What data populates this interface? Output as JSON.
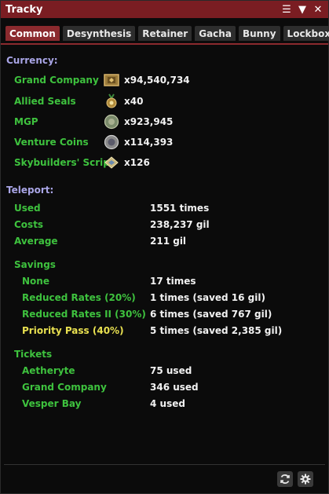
{
  "window": {
    "title": "Tracky"
  },
  "tabs": [
    "Common",
    "Desynthesis",
    "Retainer",
    "Gacha",
    "Bunny",
    "Lockbox"
  ],
  "currency": {
    "heading": "Currency:",
    "items": [
      {
        "label": "Grand Company",
        "value": "x94,540,734",
        "icon": "grand-company-seal-icon"
      },
      {
        "label": "Allied Seals",
        "value": "x40",
        "icon": "allied-seal-icon"
      },
      {
        "label": "MGP",
        "value": "x923,945",
        "icon": "mgp-coin-icon"
      },
      {
        "label": "Venture Coins",
        "value": "x114,393",
        "icon": "venture-coin-icon"
      },
      {
        "label": "Skybuilders' Scrip",
        "value": "x126",
        "icon": "skybuilders-scrip-icon"
      }
    ]
  },
  "teleport": {
    "heading": "Teleport:",
    "stats": [
      {
        "label": "Used",
        "value": "1551 times"
      },
      {
        "label": "Costs",
        "value": "238,237 gil"
      },
      {
        "label": "Average",
        "value": "211 gil"
      }
    ],
    "savings": {
      "heading": "Savings",
      "items": [
        {
          "label": "None",
          "value": "17 times"
        },
        {
          "label": "Reduced Rates (20%)",
          "value": "1 times (saved 16 gil)"
        },
        {
          "label": "Reduced Rates II (30%)",
          "value": "6 times (saved 767 gil)"
        },
        {
          "label": "Priority Pass (40%)",
          "value": "5 times (saved 2,385 gil)"
        }
      ]
    },
    "tickets": {
      "heading": "Tickets",
      "items": [
        {
          "label": "Aetheryte",
          "value": "75 used"
        },
        {
          "label": "Grand Company",
          "value": "346 used"
        },
        {
          "label": "Vesper Bay",
          "value": "4 used"
        }
      ]
    }
  },
  "colors": {
    "title_bar": "#7a1d22",
    "active_tab": "#8b2a2e",
    "heading": "#a9a5e6",
    "label_green": "#3ec23e",
    "label_yellow": "#e8e050"
  }
}
